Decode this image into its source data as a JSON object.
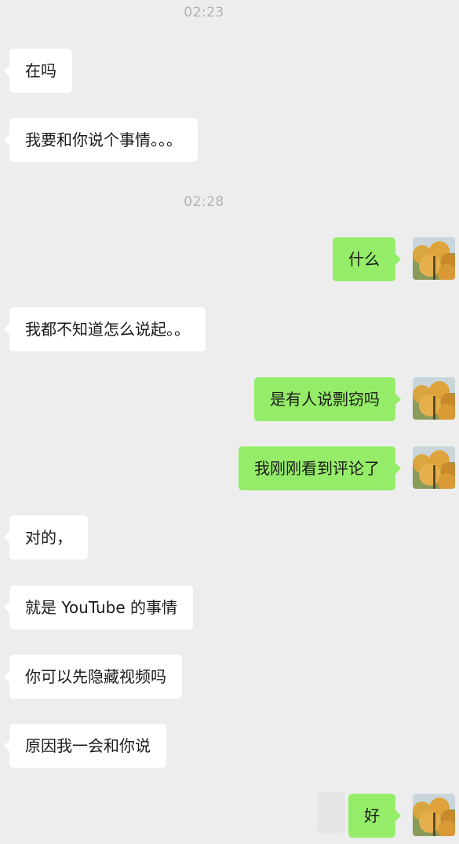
{
  "timestamps": [
    "02:23",
    "02:28"
  ],
  "messages": [
    {
      "side": "left",
      "text": "在吗"
    },
    {
      "side": "left",
      "text": "我要和你说个事情。。。"
    },
    {
      "side": "right",
      "text": "什么"
    },
    {
      "side": "left",
      "text": "我都不知道怎么说起。。"
    },
    {
      "side": "right",
      "text": "是有人说剽窃吗"
    },
    {
      "side": "right",
      "text": "我刚刚看到评论了"
    },
    {
      "side": "left",
      "text": "对的，"
    },
    {
      "side": "left",
      "text": "就是 YouTube 的事情"
    },
    {
      "side": "left",
      "text": "你可以先隐藏视频吗"
    },
    {
      "side": "left",
      "text": "原因我一会和你说"
    },
    {
      "side": "right",
      "text": "好"
    }
  ],
  "colors": {
    "background": "#ededed",
    "incoming_bubble": "#ffffff",
    "outgoing_bubble": "#95ec69",
    "timestamp": "#b2b2b2"
  },
  "icons": {
    "avatar": "autumn-tree-avatar-icon"
  }
}
